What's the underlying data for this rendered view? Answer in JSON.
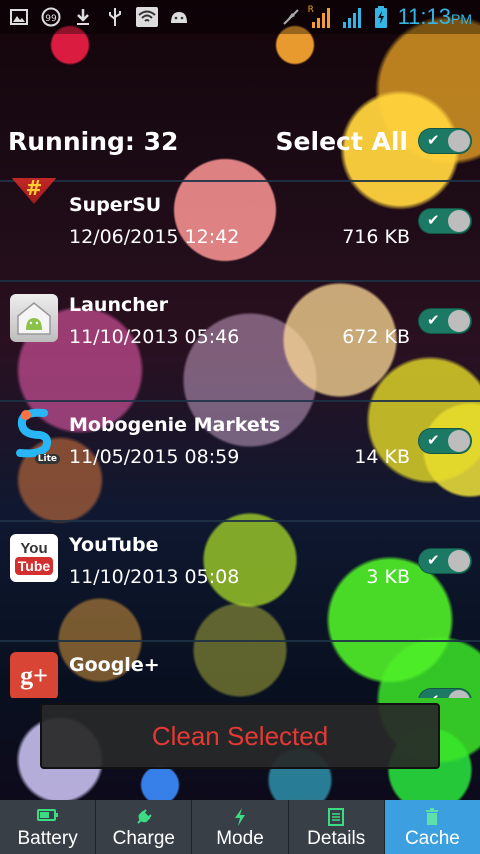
{
  "status_bar": {
    "notification_icons": [
      "image-icon",
      "badge-99-icon",
      "download-icon",
      "usb-icon",
      "wifi-icon",
      "android-icon"
    ],
    "badge_count": "99",
    "network_label": "R",
    "time": "11:13",
    "ampm": "PM"
  },
  "header": {
    "running_label": "Running: 32",
    "select_all_label": "Select All",
    "select_all_checked": true
  },
  "apps": [
    {
      "name": "SuperSU",
      "date": "12/06/2015 12:42",
      "size": "716 KB",
      "icon": "supersu-icon",
      "icon_text": "#",
      "checked": true
    },
    {
      "name": "Launcher",
      "date": "11/10/2013 05:46",
      "size": "672 KB",
      "icon": "android-launcher-icon",
      "icon_text": "☗",
      "checked": true
    },
    {
      "name": "Mobogenie Markets",
      "date": "11/05/2015 08:59",
      "size": "14 KB",
      "icon": "mobogenie-icon",
      "icon_text": "S",
      "icon_badge": "Lite",
      "checked": true
    },
    {
      "name": "YouTube",
      "date": "11/10/2013 05:08",
      "size": "3 KB",
      "icon": "youtube-icon",
      "icon_text": "You",
      "icon_text2": "Tube",
      "checked": true
    },
    {
      "name": "Google+",
      "date": "",
      "size": "",
      "icon": "google-plus-icon",
      "icon_text": "g+",
      "checked": true
    }
  ],
  "clean_button": {
    "label": "Clean Selected"
  },
  "tabs": [
    {
      "label": "Battery",
      "icon": "battery-icon",
      "active": false
    },
    {
      "label": "Charge",
      "icon": "plug-icon",
      "active": false
    },
    {
      "label": "Mode",
      "icon": "lightning-icon",
      "active": false
    },
    {
      "label": "Details",
      "icon": "list-icon",
      "active": false
    },
    {
      "label": "Cache",
      "icon": "trash-icon",
      "active": true
    }
  ],
  "colors": {
    "accent_blue": "#33b5e5",
    "toggle_on": "#1c7a64",
    "clean_text": "#e53935",
    "tab_active": "#3ca0e0",
    "tab_bg": "#383f47"
  }
}
